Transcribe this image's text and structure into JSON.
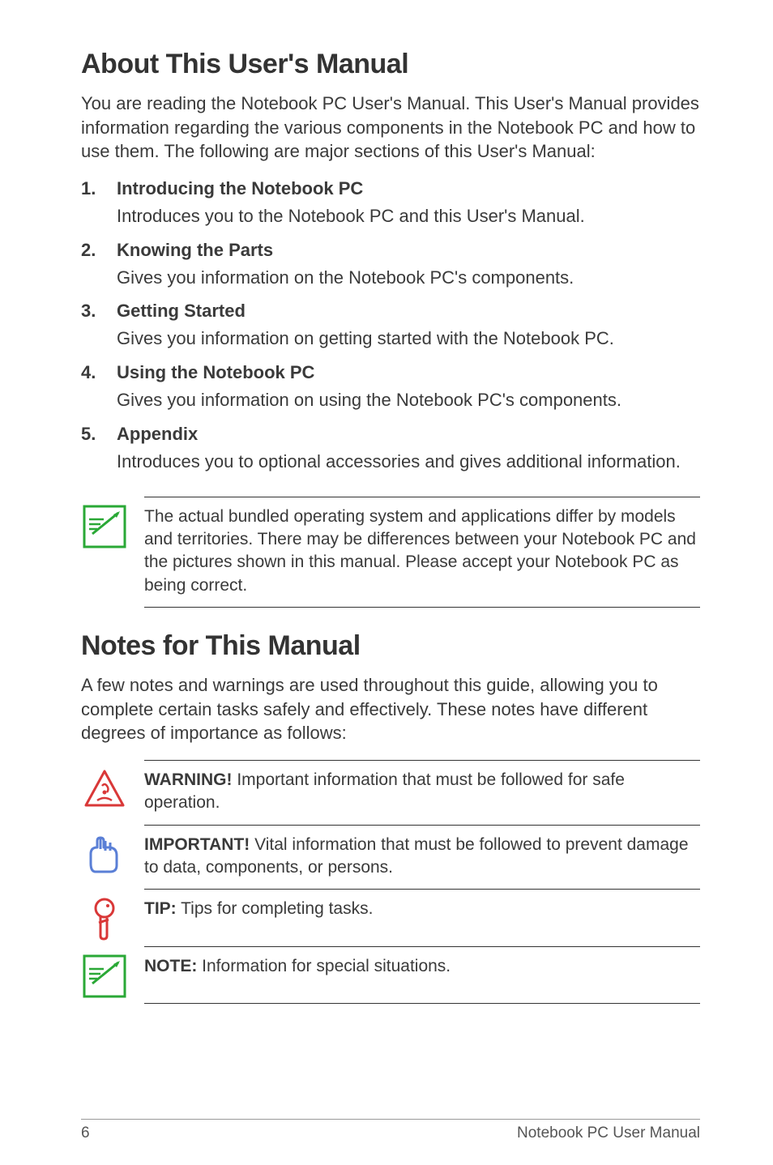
{
  "heading1": "About This User's Manual",
  "intro": "You are reading the Notebook PC User's Manual. This User's Manual provides information regarding the various components in the Notebook PC and how to use them. The following are major sections of this User's Manual:",
  "items": [
    {
      "num": "1.",
      "title": "Introducing the Notebook PC",
      "desc": "Introduces you to the Notebook PC and this User's Manual."
    },
    {
      "num": "2.",
      "title": "Knowing the Parts",
      "desc": "Gives you information on the Notebook PC's components."
    },
    {
      "num": "3.",
      "title": "Getting Started",
      "desc": "Gives you information on getting started with the Notebook PC."
    },
    {
      "num": "4.",
      "title": "Using the Notebook PC",
      "desc": "Gives you information on using the Notebook PC's components."
    },
    {
      "num": "5.",
      "title": "Appendix",
      "desc": "Introduces you to optional accessories and gives additional information."
    }
  ],
  "topNote": "The actual bundled operating system and applications differ by models and territories. There may be differences between your Notebook PC and the pictures shown in this manual. Please accept your Notebook PC as being correct.",
  "heading2": "Notes for This Manual",
  "notesIntro": "A few notes and warnings are used throughout this guide, allowing you to complete certain tasks safely and effectively. These notes have different degrees of importance as follows:",
  "warning": {
    "label": "WARNING!",
    "text": " Important information that must be followed for safe operation."
  },
  "important": {
    "label": "IMPORTANT!",
    "text": " Vital information that must be followed to prevent damage to data, components, or persons."
  },
  "tip": {
    "label": "TIP:",
    "text": " Tips for completing tasks."
  },
  "note": {
    "label": "NOTE:",
    "text": "  Information for special situations."
  },
  "footer": {
    "page": "6",
    "title": "Notebook PC User Manual"
  }
}
